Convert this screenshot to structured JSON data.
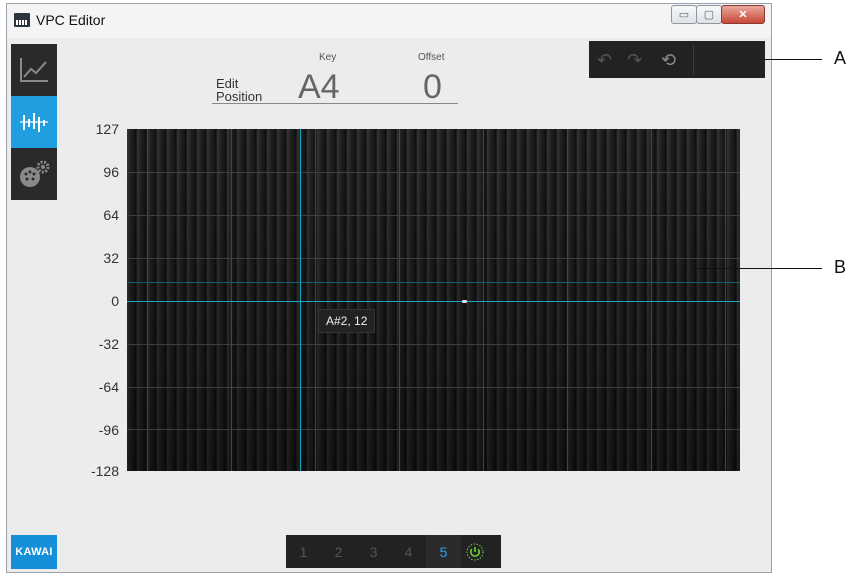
{
  "window": {
    "title": "VPC Editor"
  },
  "titlebar_buttons": {
    "minimize": "▭",
    "maximize": "▢",
    "close": "✕"
  },
  "sidebar": {
    "items": [
      {
        "name": "curve-view",
        "icon": "line-chart-icon"
      },
      {
        "name": "offset-view",
        "icon": "offset-bars-icon",
        "active": true
      },
      {
        "name": "device-settings",
        "icon": "midi-gear-icon"
      }
    ],
    "logo": "KAWAI"
  },
  "edit_position": {
    "label_line1": "Edit",
    "label_line2": "Position",
    "key_label": "Key",
    "key_value": "A4",
    "offset_label": "Offset",
    "offset_value": "0"
  },
  "toolbar": {
    "undo_icon": "↶",
    "redo_icon": "↷",
    "reset_icon": "⟲"
  },
  "graph": {
    "y_ticks": [
      "127",
      "96",
      "64",
      "32",
      "0",
      "-32",
      "-64",
      "-96",
      "-128"
    ],
    "y_range": [
      -128,
      127
    ],
    "tooltip": "A#2, 12"
  },
  "pages": {
    "items": [
      "1",
      "2",
      "3",
      "4",
      "5"
    ],
    "active": "5"
  },
  "annotations": {
    "a": "A",
    "b": "B"
  },
  "colors": {
    "accent": "#1f9ee0",
    "cursor": "#1aa3c4",
    "power": "#6fd13a"
  }
}
